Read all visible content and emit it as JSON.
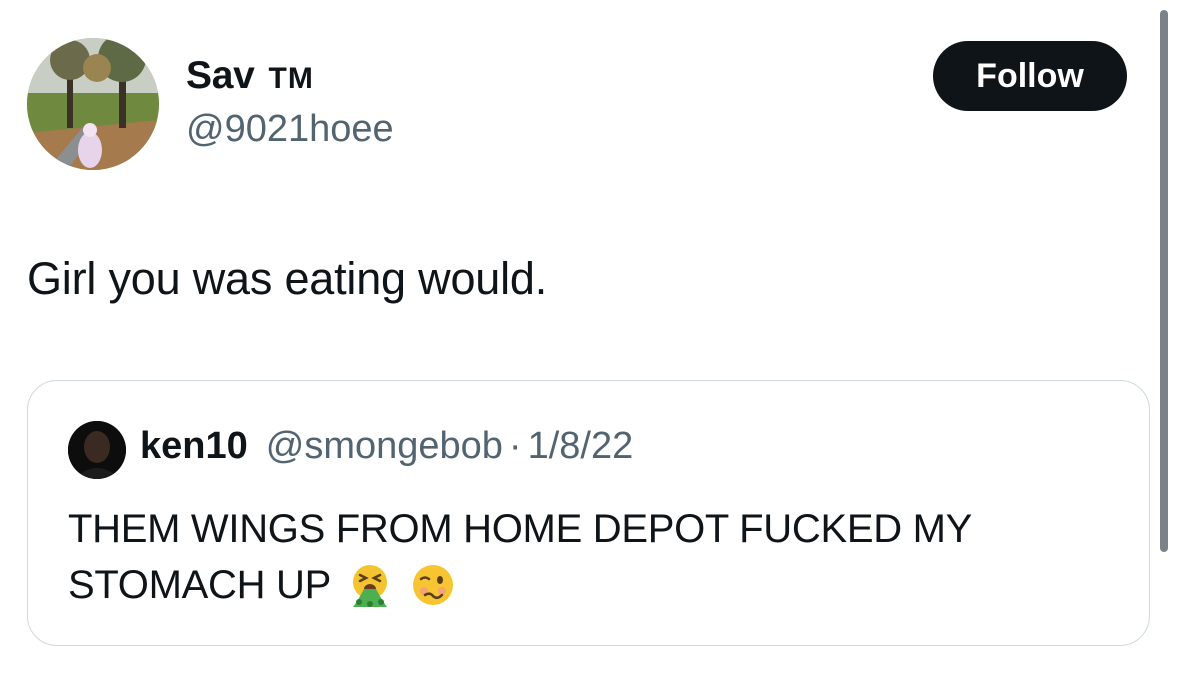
{
  "tweet": {
    "author": {
      "display_name": "Sav",
      "badge": "TM",
      "handle": "@9021hoee"
    },
    "follow_label": "Follow",
    "text": "Girl you was eating would."
  },
  "quoted_tweet": {
    "author": {
      "display_name": "ken10",
      "handle": "@smongebob"
    },
    "separator": "·",
    "date": "1/8/22",
    "text": "THEM WINGS FROM HOME DEPOT FUCKED MY STOMACH UP",
    "emojis": [
      "vomiting-face-icon",
      "woozy-face-icon"
    ]
  },
  "colors": {
    "text_primary": "#0f1419",
    "text_secondary": "#536471",
    "button_bg": "#0f1419",
    "border": "#cfd9de"
  }
}
